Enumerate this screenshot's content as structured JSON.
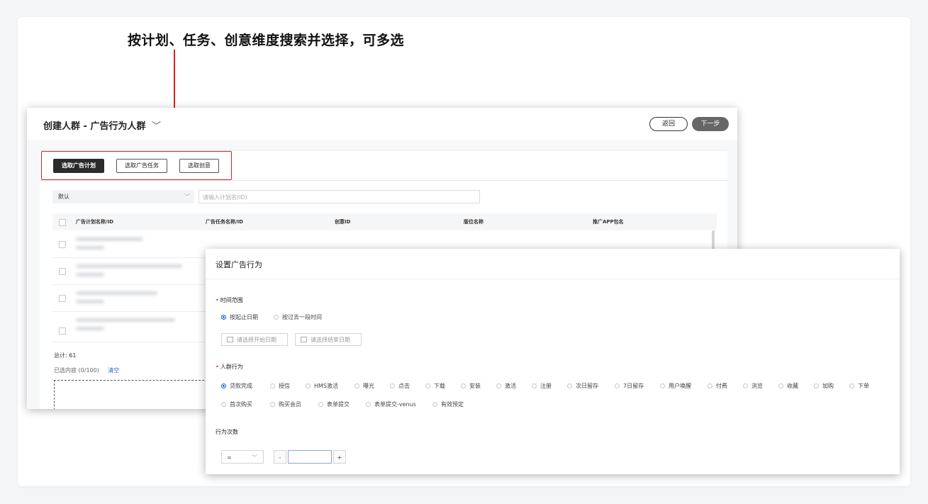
{
  "callout": "按计划、任务、创意维度搜索并选择，可多选",
  "window1": {
    "title": "创建人群 - 广告行为人群",
    "title_chevron": "﹀",
    "back_label": "返回",
    "next_label": "下一步",
    "tabs": [
      {
        "label": "选取广告计划",
        "active": true
      },
      {
        "label": "选取广告任务",
        "active": false
      },
      {
        "label": "选取创意",
        "active": false
      }
    ],
    "filter_default": "默认",
    "search_placeholder": "请输入计划名(ID)",
    "columns": [
      "广告计划名称/ID",
      "广告任务名称/ID",
      "创意ID",
      "版位名称",
      "推广APP包名"
    ],
    "total": "总计: 61",
    "selected_label": "已选内容 (0/100)",
    "clear_label": "清空"
  },
  "window2": {
    "title": "设置广告行为",
    "time_range_label": "时间范围",
    "time_options": [
      {
        "label": "按起止日期",
        "selected": true
      },
      {
        "label": "按过去一段时间",
        "selected": false
      }
    ],
    "start_date_placeholder": "请选择开始日期",
    "end_date_placeholder": "请选择结束日期",
    "behavior_label": "人群行为",
    "behaviors": [
      {
        "label": "贷款完成",
        "selected": true
      },
      {
        "label": "授信",
        "selected": false
      },
      {
        "label": "HMS激活",
        "selected": false
      },
      {
        "label": "曝光",
        "selected": false
      },
      {
        "label": "点击",
        "selected": false
      },
      {
        "label": "下载",
        "selected": false
      },
      {
        "label": "安装",
        "selected": false
      },
      {
        "label": "激活",
        "selected": false
      },
      {
        "label": "注册",
        "selected": false
      },
      {
        "label": "次日留存",
        "selected": false
      },
      {
        "label": "7日留存",
        "selected": false
      },
      {
        "label": "用户唤醒",
        "selected": false
      },
      {
        "label": "付费",
        "selected": false
      },
      {
        "label": "浏览",
        "selected": false
      },
      {
        "label": "收藏",
        "selected": false
      },
      {
        "label": "加购",
        "selected": false
      },
      {
        "label": "下单",
        "selected": false
      },
      {
        "label": "首次购买",
        "selected": false
      },
      {
        "label": "购买会员",
        "selected": false
      },
      {
        "label": "表单提交",
        "selected": false
      },
      {
        "label": "表单提交-venus",
        "selected": false
      },
      {
        "label": "有效预定",
        "selected": false
      }
    ],
    "count_label": "行为次数",
    "operator_value": "=",
    "minus_label": "-",
    "plus_label": "+"
  },
  "colors": {
    "annotation_red": "#e02020",
    "radio_blue": "#1f5fd6",
    "active_tab": "#2b2b2b"
  }
}
